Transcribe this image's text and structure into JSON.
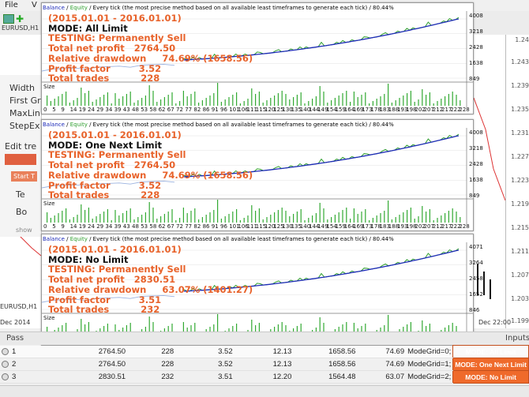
{
  "menu": {
    "file": "File",
    "view_initial": "V"
  },
  "background": {
    "symbol_tab": "EURUSD,H1",
    "left_labels": [
      "Width",
      "First Gr",
      "MaxLin",
      "StepEx",
      "Edit tre",
      "Start T",
      "Te",
      "Bo",
      "show"
    ],
    "bottom_tab": "EURUSD,H1",
    "date_left": "Dec 2014",
    "time_right": "Dec 22:00",
    "pass_label": "Pass",
    "inputs_label": "Inputs",
    "right_prices": [
      "1.24",
      "1.243",
      "1.239",
      "1.235",
      "1.231",
      "1.227",
      "1.223",
      "1.219",
      "1.215",
      "1.211",
      "1.207",
      "1.203",
      "1.199"
    ]
  },
  "header_text": {
    "balance": "Balance",
    "sep": " / ",
    "equity": "Equity",
    "rest": " / Every tick (the most precise method based on all available least timeframes to generate each tick) / 80.44%"
  },
  "panels": [
    {
      "period": "(2015.01.01 - 2016.01.01)",
      "mode": "MODE: All Limit",
      "testing": "TESTING: Permanently Sell",
      "net_profit": "Total net profit   2764.50",
      "drawdown": "Relative drawdown     74.69% (1658.56)",
      "profit_factor": "Profit factor         3.52",
      "total_trades": "Total trades          228",
      "yticks": [
        "4008",
        "3218",
        "2428",
        "1638",
        "849"
      ],
      "xticks": [
        "0",
        "5",
        "9",
        "14",
        "19",
        "24",
        "29",
        "34",
        "39",
        "43",
        "48",
        "53",
        "58",
        "62",
        "67",
        "72",
        "77",
        "82",
        "86",
        "91",
        "96",
        "101",
        "106",
        "111",
        "115",
        "120",
        "125",
        "130",
        "135",
        "140",
        "144",
        "149",
        "154",
        "159",
        "164",
        "169",
        "173",
        "178",
        "183",
        "188",
        "193",
        "198",
        "202",
        "207",
        "212",
        "217",
        "222",
        "228"
      ],
      "size_label": "Size"
    },
    {
      "period": "(2015.01.01 - 2016.01.01)",
      "mode": "MODE: One Next Limit",
      "testing": "TESTING: Permanently Sell",
      "net_profit": "Total net profit   2764.50",
      "drawdown": "Relative drawdown     74.69% (1658.56)",
      "profit_factor": "Profit factor         3.52",
      "total_trades": "Total trades          228",
      "yticks": [
        "4008",
        "3218",
        "2428",
        "1638",
        "849"
      ],
      "xticks": [
        "0",
        "5",
        "9",
        "14",
        "19",
        "24",
        "29",
        "34",
        "39",
        "43",
        "48",
        "53",
        "58",
        "62",
        "67",
        "72",
        "77",
        "82",
        "86",
        "91",
        "96",
        "101",
        "106",
        "111",
        "115",
        "120",
        "125",
        "130",
        "135",
        "140",
        "144",
        "149",
        "154",
        "159",
        "164",
        "169",
        "173",
        "178",
        "183",
        "188",
        "193",
        "198",
        "202",
        "207",
        "212",
        "217",
        "222",
        "228"
      ],
      "size_label": "Size"
    },
    {
      "period": "(2015.01.01 - 2016.01.01)",
      "mode": "MODE: No Limit",
      "testing": "TESTING: Permanently Sell",
      "net_profit": "Total net profit   2830.51",
      "drawdown": "Relative drawdown     63.07% (1401.27)",
      "profit_factor": "Profit factor         3.51",
      "total_trades": "Total trades          232",
      "yticks": [
        "4071",
        "3264",
        "2458",
        "1652",
        "846"
      ],
      "xticks": [
        "0",
        "5",
        "10",
        "15",
        "20",
        "25",
        "30",
        "35",
        "40",
        "44",
        "49",
        "54",
        "59",
        "64",
        "69",
        "74",
        "78",
        "83",
        "88",
        "93",
        "98",
        "103",
        "108",
        "113",
        "117",
        "122",
        "127",
        "132",
        "137",
        "142",
        "147",
        "151",
        "156",
        "161",
        "166",
        "171",
        "176",
        "181",
        "186",
        "190",
        "195",
        "200",
        "205",
        "210",
        "215",
        "220",
        "225",
        "232"
      ],
      "size_label": "Size"
    }
  ],
  "table": {
    "rows": [
      {
        "pass": "1",
        "profit": "2764.50",
        "trades": "228",
        "pf": "3.52",
        "payoff": "12.13",
        "dd_abs": "1658.56",
        "dd_pct": "74.69",
        "input": "ModeGrid=0;",
        "mode_label": "MODE: All Limit"
      },
      {
        "pass": "2",
        "profit": "2764.50",
        "trades": "228",
        "pf": "3.52",
        "payoff": "12.13",
        "dd_abs": "1658.56",
        "dd_pct": "74.69",
        "input": "ModeGrid=1;",
        "mode_label": "MODE: One Next Limit"
      },
      {
        "pass": "3",
        "profit": "2830.51",
        "trades": "232",
        "pf": "3.51",
        "payoff": "12.20",
        "dd_abs": "1564.48",
        "dd_pct": "63.07",
        "input": "ModeGrid=2;",
        "mode_label": "MODE: No Limit"
      }
    ]
  },
  "colors": {
    "orange": "#e8622a",
    "balance": "#1e2bb8",
    "equity": "#2e9e2e",
    "volume": "#33aa33",
    "mode_button": "#ef6a2b"
  }
}
